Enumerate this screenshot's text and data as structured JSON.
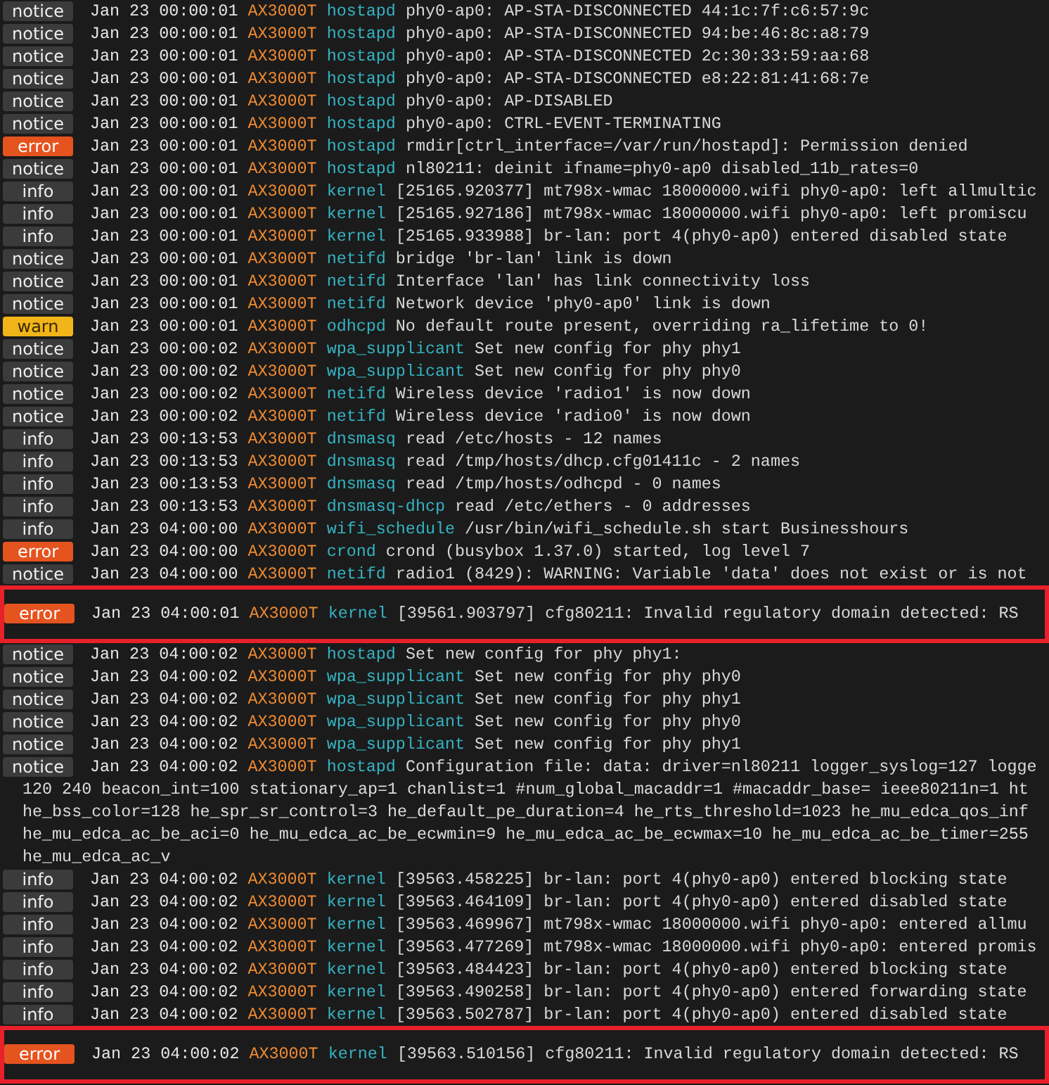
{
  "entries": [
    {
      "level": "notice",
      "time": "Jan 23 00:00:01",
      "host": "AX3000T",
      "source": "hostapd",
      "message": "phy0-ap0: AP-STA-DISCONNECTED 44:1c:7f:c6:57:9c",
      "highlighted": false
    },
    {
      "level": "notice",
      "time": "Jan 23 00:00:01",
      "host": "AX3000T",
      "source": "hostapd",
      "message": "phy0-ap0: AP-STA-DISCONNECTED 94:be:46:8c:a8:79",
      "highlighted": false
    },
    {
      "level": "notice",
      "time": "Jan 23 00:00:01",
      "host": "AX3000T",
      "source": "hostapd",
      "message": "phy0-ap0: AP-STA-DISCONNECTED 2c:30:33:59:aa:68",
      "highlighted": false
    },
    {
      "level": "notice",
      "time": "Jan 23 00:00:01",
      "host": "AX3000T",
      "source": "hostapd",
      "message": "phy0-ap0: AP-STA-DISCONNECTED e8:22:81:41:68:7e",
      "highlighted": false
    },
    {
      "level": "notice",
      "time": "Jan 23 00:00:01",
      "host": "AX3000T",
      "source": "hostapd",
      "message": "phy0-ap0: AP-DISABLED",
      "highlighted": false
    },
    {
      "level": "notice",
      "time": "Jan 23 00:00:01",
      "host": "AX3000T",
      "source": "hostapd",
      "message": "phy0-ap0: CTRL-EVENT-TERMINATING",
      "highlighted": false
    },
    {
      "level": "error",
      "time": "Jan 23 00:00:01",
      "host": "AX3000T",
      "source": "hostapd",
      "message": "rmdir[ctrl_interface=/var/run/hostapd]: Permission denied",
      "highlighted": false
    },
    {
      "level": "notice",
      "time": "Jan 23 00:00:01",
      "host": "AX3000T",
      "source": "hostapd",
      "message": "nl80211: deinit ifname=phy0-ap0 disabled_11b_rates=0",
      "highlighted": false
    },
    {
      "level": "info",
      "time": "Jan 23 00:00:01",
      "host": "AX3000T",
      "source": "kernel",
      "message": "[25165.920377] mt798x-wmac 18000000.wifi phy0-ap0: left allmultic",
      "highlighted": false
    },
    {
      "level": "info",
      "time": "Jan 23 00:00:01",
      "host": "AX3000T",
      "source": "kernel",
      "message": "[25165.927186] mt798x-wmac 18000000.wifi phy0-ap0: left promiscu",
      "highlighted": false
    },
    {
      "level": "info",
      "time": "Jan 23 00:00:01",
      "host": "AX3000T",
      "source": "kernel",
      "message": "[25165.933988] br-lan: port 4(phy0-ap0) entered disabled state",
      "highlighted": false
    },
    {
      "level": "notice",
      "time": "Jan 23 00:00:01",
      "host": "AX3000T",
      "source": "netifd",
      "message": "bridge 'br-lan' link is down",
      "highlighted": false
    },
    {
      "level": "notice",
      "time": "Jan 23 00:00:01",
      "host": "AX3000T",
      "source": "netifd",
      "message": "Interface 'lan' has link connectivity loss",
      "highlighted": false
    },
    {
      "level": "notice",
      "time": "Jan 23 00:00:01",
      "host": "AX3000T",
      "source": "netifd",
      "message": "Network device 'phy0-ap0' link is down",
      "highlighted": false
    },
    {
      "level": "warn",
      "time": "Jan 23 00:00:01",
      "host": "AX3000T",
      "source": "odhcpd",
      "message": "No default route present, overriding ra_lifetime to 0!",
      "highlighted": false
    },
    {
      "level": "notice",
      "time": "Jan 23 00:00:02",
      "host": "AX3000T",
      "source": "wpa_supplicant",
      "message": "Set new config for phy phy1",
      "highlighted": false
    },
    {
      "level": "notice",
      "time": "Jan 23 00:00:02",
      "host": "AX3000T",
      "source": "wpa_supplicant",
      "message": "Set new config for phy phy0",
      "highlighted": false
    },
    {
      "level": "notice",
      "time": "Jan 23 00:00:02",
      "host": "AX3000T",
      "source": "netifd",
      "message": "Wireless device 'radio1' is now down",
      "highlighted": false
    },
    {
      "level": "notice",
      "time": "Jan 23 00:00:02",
      "host": "AX3000T",
      "source": "netifd",
      "message": "Wireless device 'radio0' is now down",
      "highlighted": false
    },
    {
      "level": "info",
      "time": "Jan 23 00:13:53",
      "host": "AX3000T",
      "source": "dnsmasq",
      "message": "read /etc/hosts - 12 names",
      "highlighted": false
    },
    {
      "level": "info",
      "time": "Jan 23 00:13:53",
      "host": "AX3000T",
      "source": "dnsmasq",
      "message": "read /tmp/hosts/dhcp.cfg01411c - 2 names",
      "highlighted": false
    },
    {
      "level": "info",
      "time": "Jan 23 00:13:53",
      "host": "AX3000T",
      "source": "dnsmasq",
      "message": "read /tmp/hosts/odhcpd - 0 names",
      "highlighted": false
    },
    {
      "level": "info",
      "time": "Jan 23 00:13:53",
      "host": "AX3000T",
      "source": "dnsmasq-dhcp",
      "message": "read /etc/ethers - 0 addresses",
      "highlighted": false
    },
    {
      "level": "info",
      "time": "Jan 23 04:00:00",
      "host": "AX3000T",
      "source": "wifi_schedule",
      "message": "/usr/bin/wifi_schedule.sh start Businesshours",
      "highlighted": false
    },
    {
      "level": "error",
      "time": "Jan 23 04:00:00",
      "host": "AX3000T",
      "source": "crond",
      "message": "crond (busybox 1.37.0) started, log level 7",
      "highlighted": false
    },
    {
      "level": "notice",
      "time": "Jan 23 04:00:00",
      "host": "AX3000T",
      "source": "netifd",
      "message": "radio1 (8429): WARNING: Variable 'data' does not exist or is not",
      "highlighted": false
    },
    {
      "level": "error",
      "time": "Jan 23 04:00:01",
      "host": "AX3000T",
      "source": "kernel",
      "message": "[39561.903797] cfg80211: Invalid regulatory domain detected: RS",
      "highlighted": true
    },
    {
      "level": "notice",
      "time": "Jan 23 04:00:02",
      "host": "AX3000T",
      "source": "hostapd",
      "message": "Set new config for phy phy1:",
      "highlighted": false
    },
    {
      "level": "notice",
      "time": "Jan 23 04:00:02",
      "host": "AX3000T",
      "source": "wpa_supplicant",
      "message": "Set new config for phy phy0",
      "highlighted": false
    },
    {
      "level": "notice",
      "time": "Jan 23 04:00:02",
      "host": "AX3000T",
      "source": "wpa_supplicant",
      "message": "Set new config for phy phy1",
      "highlighted": false
    },
    {
      "level": "notice",
      "time": "Jan 23 04:00:02",
      "host": "AX3000T",
      "source": "wpa_supplicant",
      "message": "Set new config for phy phy0",
      "highlighted": false
    },
    {
      "level": "notice",
      "time": "Jan 23 04:00:02",
      "host": "AX3000T",
      "source": "wpa_supplicant",
      "message": "Set new config for phy phy1",
      "highlighted": false
    },
    {
      "level": "notice",
      "time": "Jan 23 04:00:02",
      "host": "AX3000T",
      "source": "hostapd",
      "message": "Configuration file: data: driver=nl80211 logger_syslog=127 logge",
      "highlighted": false,
      "continuation": [
        "120 240 beacon_int=100 stationary_ap=1 chanlist=1 #num_global_macaddr=1 #macaddr_base= ieee80211n=1 ht",
        "he_bss_color=128 he_spr_sr_control=3 he_default_pe_duration=4 he_rts_threshold=1023 he_mu_edca_qos_inf",
        "he_mu_edca_ac_be_aci=0 he_mu_edca_ac_be_ecwmin=9 he_mu_edca_ac_be_ecwmax=10 he_mu_edca_ac_be_timer=255",
        "he_mu_edca_ac_v"
      ]
    },
    {
      "level": "info",
      "time": "Jan 23 04:00:02",
      "host": "AX3000T",
      "source": "kernel",
      "message": "[39563.458225] br-lan: port 4(phy0-ap0) entered blocking state",
      "highlighted": false
    },
    {
      "level": "info",
      "time": "Jan 23 04:00:02",
      "host": "AX3000T",
      "source": "kernel",
      "message": "[39563.464109] br-lan: port 4(phy0-ap0) entered disabled state",
      "highlighted": false
    },
    {
      "level": "info",
      "time": "Jan 23 04:00:02",
      "host": "AX3000T",
      "source": "kernel",
      "message": "[39563.469967] mt798x-wmac 18000000.wifi phy0-ap0: entered allmu",
      "highlighted": false
    },
    {
      "level": "info",
      "time": "Jan 23 04:00:02",
      "host": "AX3000T",
      "source": "kernel",
      "message": "[39563.477269] mt798x-wmac 18000000.wifi phy0-ap0: entered promis",
      "highlighted": false
    },
    {
      "level": "info",
      "time": "Jan 23 04:00:02",
      "host": "AX3000T",
      "source": "kernel",
      "message": "[39563.484423] br-lan: port 4(phy0-ap0) entered blocking state",
      "highlighted": false
    },
    {
      "level": "info",
      "time": "Jan 23 04:00:02",
      "host": "AX3000T",
      "source": "kernel",
      "message": "[39563.490258] br-lan: port 4(phy0-ap0) entered forwarding state",
      "highlighted": false
    },
    {
      "level": "info",
      "time": "Jan 23 04:00:02",
      "host": "AX3000T",
      "source": "kernel",
      "message": "[39563.502787] br-lan: port 4(phy0-ap0) entered disabled state",
      "highlighted": false
    },
    {
      "level": "error",
      "time": "Jan 23 04:00:02",
      "host": "AX3000T",
      "source": "kernel",
      "message": "[39563.510156] cfg80211: Invalid regulatory domain detected: RS",
      "highlighted": true
    }
  ]
}
